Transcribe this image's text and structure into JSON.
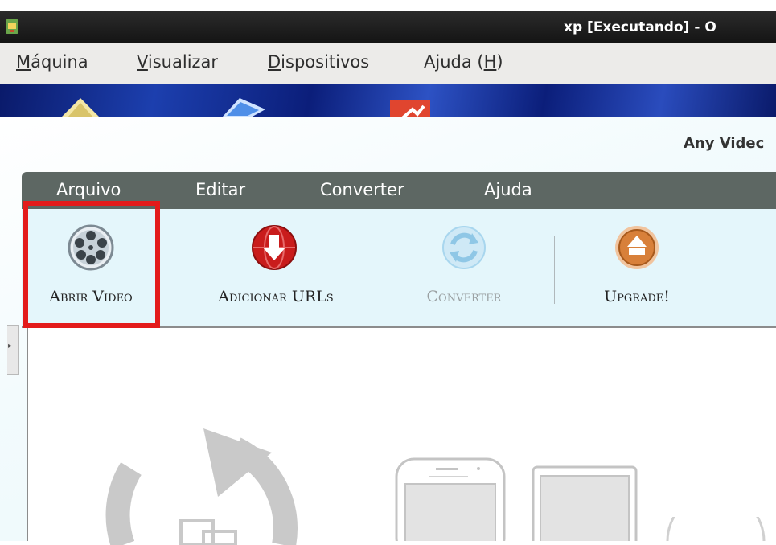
{
  "window": {
    "title": "xp [Executando] - O"
  },
  "host_menu": [
    {
      "pre": "",
      "ul": "M",
      "post": "áquina"
    },
    {
      "pre": "",
      "ul": "V",
      "post": "isualizar"
    },
    {
      "pre": "",
      "ul": "D",
      "post": "ispositivos"
    },
    {
      "pre": "Ajuda (",
      "ul": "H",
      "post": ")"
    }
  ],
  "app": {
    "title": "Any Videc",
    "menu": [
      "Arquivo",
      "Editar",
      "Converter",
      "Ajuda"
    ],
    "toolbar": {
      "open_video": "Abrir Video",
      "add_urls": "Adicionar URLs",
      "convert": "Converter",
      "upgrade": "Upgrade!"
    }
  },
  "colors": {
    "highlight": "#e31b1b",
    "upgrade_accent": "#d8803a",
    "add_urls_accent": "#c91c1c",
    "convert_disabled": "#8fc7e6"
  }
}
